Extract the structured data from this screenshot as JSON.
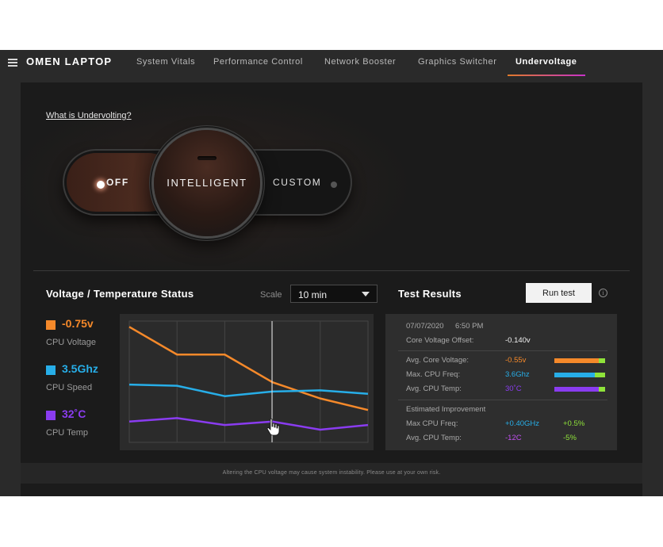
{
  "app": {
    "title": "OMEN LAPTOP"
  },
  "nav": {
    "tabs": [
      {
        "label": "System Vitals"
      },
      {
        "label": "Performance Control"
      },
      {
        "label": "Network Booster"
      },
      {
        "label": "Graphics Switcher"
      },
      {
        "label": "Undervoltage",
        "active": true
      }
    ]
  },
  "undervolt": {
    "help_link": "What is Undervolting?",
    "modes": {
      "off": "OFF",
      "intelligent": "INTELLIGENT",
      "custom": "CUSTOM"
    },
    "selected_mode": "INTELLIGENT"
  },
  "status": {
    "title": "Voltage / Temperature Status",
    "scale_label": "Scale",
    "scale_value": "10 min",
    "metrics": [
      {
        "value": "-0.75v",
        "label": "CPU Voltage",
        "color": "#f5892a"
      },
      {
        "value": "3.5Ghz",
        "label": "CPU Speed",
        "color": "#27aee8"
      },
      {
        "value": "32˚C",
        "label": "CPU Temp",
        "color": "#8a3cf0"
      }
    ]
  },
  "chart_data": {
    "type": "line",
    "x": [
      0,
      1,
      2,
      3,
      4,
      5
    ],
    "series": [
      {
        "values": [
          100,
          76,
          76,
          52,
          38,
          28
        ],
        "color": "#f5892a"
      },
      {
        "values": [
          50,
          49,
          40,
          44,
          45,
          42
        ],
        "color": "#27aee8"
      },
      {
        "values": [
          18,
          21,
          15,
          18,
          11,
          15
        ],
        "color": "#8a3cf0"
      }
    ],
    "ylim": [
      0,
      105
    ],
    "grid": true
  },
  "results": {
    "title": "Test Results",
    "run_button": "Run test",
    "date": "07/07/2020",
    "time": "6:50 PM",
    "core_voltage_offset_label": "Core Voltage Offset:",
    "core_voltage_offset_value": "-0.140v",
    "rows": [
      {
        "label": "Avg. Core Voltage:",
        "value": "-0.55v",
        "color": "#f5892a",
        "level": 0.88
      },
      {
        "label": "Max. CPU Freq:",
        "value": "3.6Ghz",
        "color": "#27aee8",
        "level": 0.8
      },
      {
        "label": "Avg. CPU Temp:",
        "value": "30˚C",
        "color": "#8a3cf0",
        "level": 0.88
      }
    ],
    "improvement": {
      "heading": "Estimated Improvement",
      "rows": [
        {
          "label": "Max CPU Freq:",
          "value": "+0.40GHz",
          "pct": "+0.5%",
          "color": "#27aee8"
        },
        {
          "label": "Avg. CPU Temp:",
          "value": "-12C",
          "pct": "-5%",
          "color": "#c050f0"
        }
      ],
      "pct_color": "#8fe33a"
    }
  },
  "footer": {
    "disclaimer": "Altering the CPU voltage may cause system instability. Please use at your own risk."
  }
}
